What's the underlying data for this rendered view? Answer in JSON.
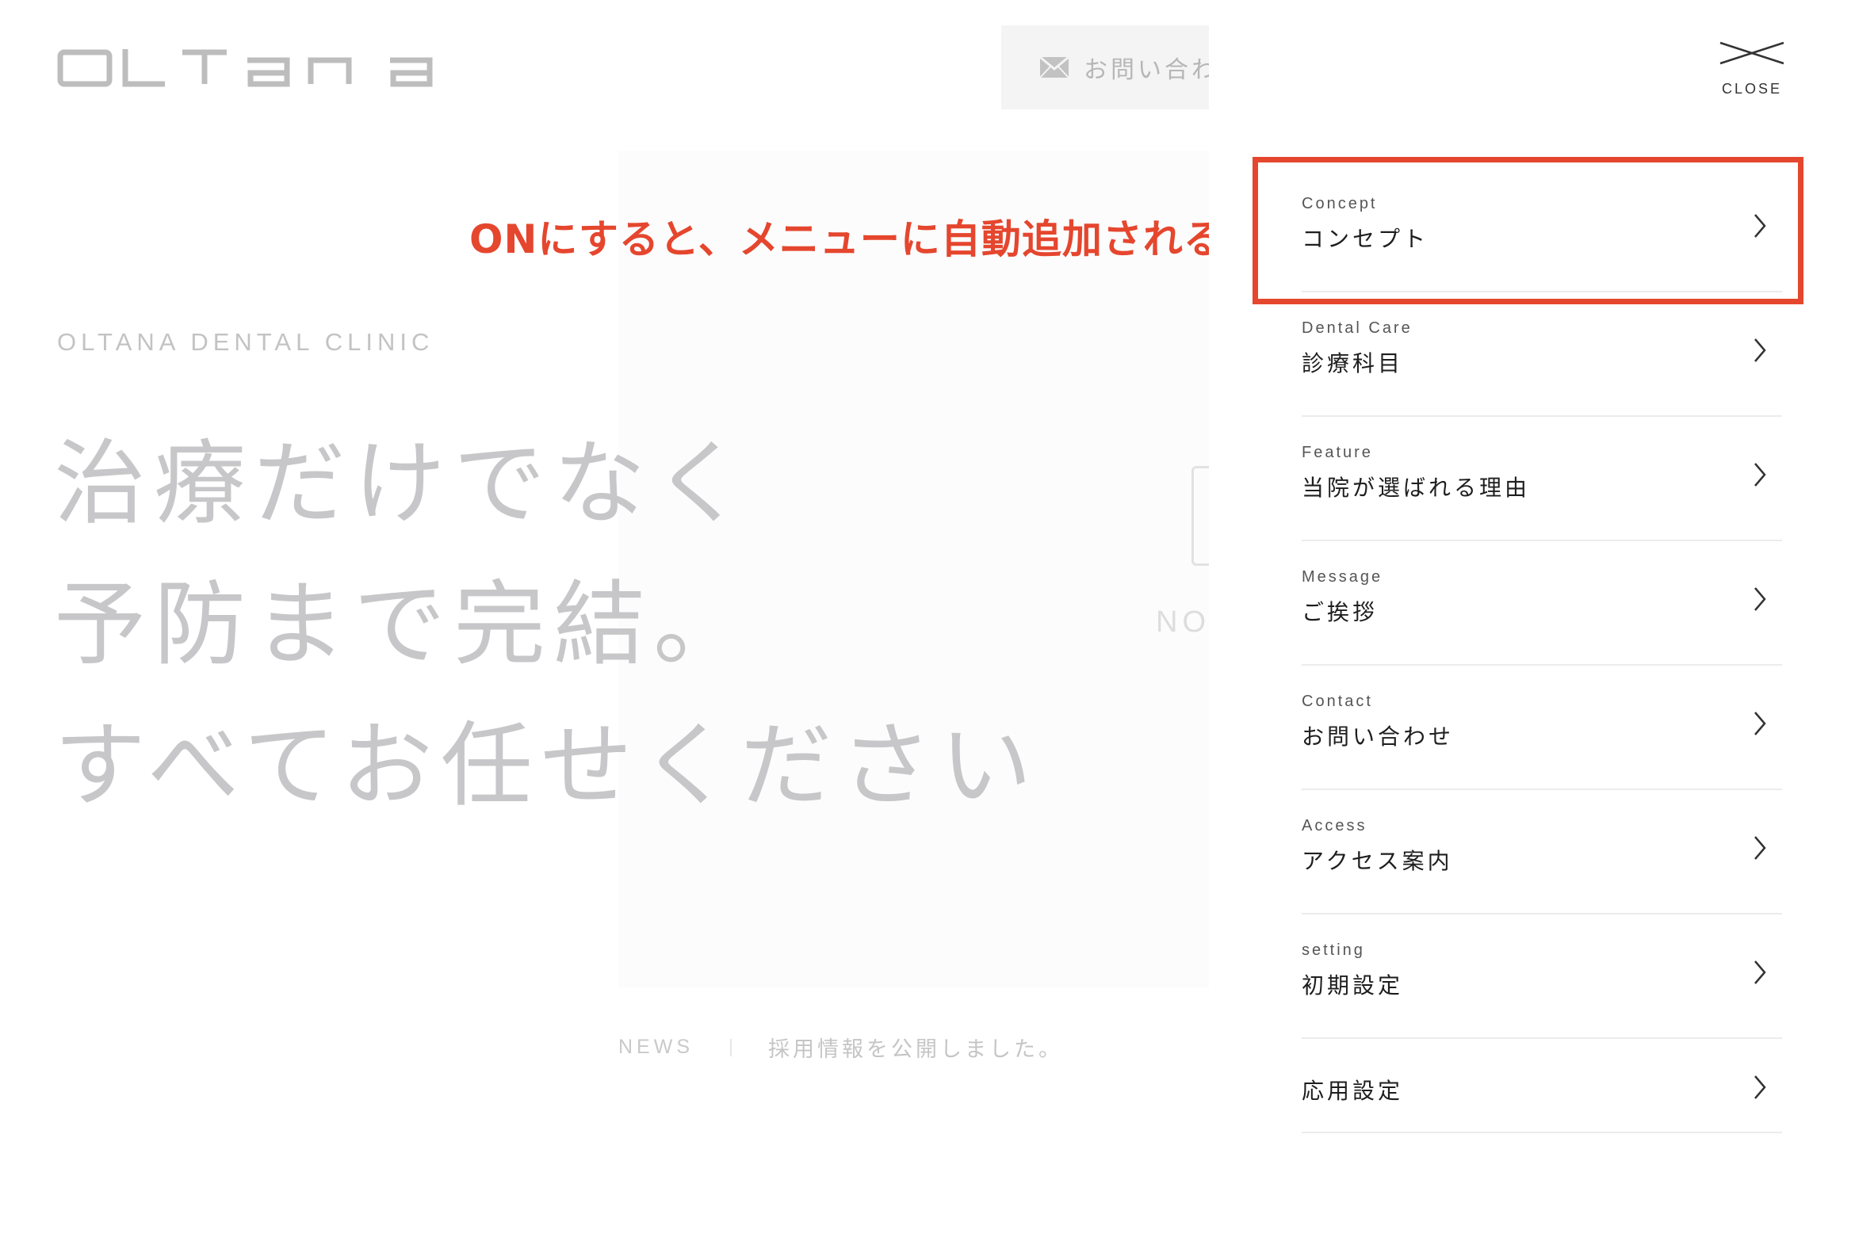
{
  "brand": {
    "logo_text": "oltana"
  },
  "header": {
    "contact_label": "お問い合わ",
    "contact_icon": "mail-icon"
  },
  "hero": {
    "clinic_name": "OLTANA DENTAL CLINIC",
    "headline": [
      "治療だけでなく",
      "予防まで完結。",
      "すべてお任せください"
    ],
    "image_placeholder_text": "NO"
  },
  "news": {
    "tag": "NEWS",
    "text": "採用情報を公開しました。"
  },
  "annotation": {
    "text": "ONにすると、メニューに自動追加される",
    "color": "#e5462e"
  },
  "drawer": {
    "close_label": "CLOSE",
    "items": [
      {
        "en": "Concept",
        "ja": "コンセプト"
      },
      {
        "en": "Dental Care",
        "ja": "診療科目"
      },
      {
        "en": "Feature",
        "ja": "当院が選ばれる理由"
      },
      {
        "en": "Message",
        "ja": "ご挨拶"
      },
      {
        "en": "Contact",
        "ja": "お問い合わせ"
      },
      {
        "en": "Access",
        "ja": "アクセス案内"
      },
      {
        "en": "setting",
        "ja": "初期設定"
      },
      {
        "en": "",
        "ja": "応用設定"
      }
    ]
  }
}
